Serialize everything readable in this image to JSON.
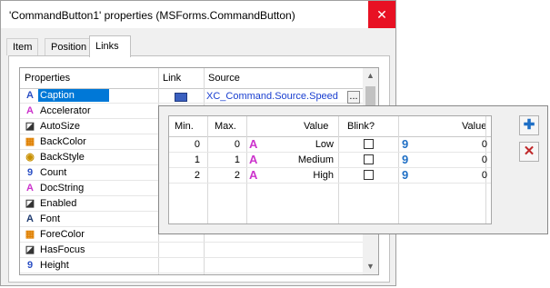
{
  "window": {
    "title": "'CommandButton1' properties (MSForms.CommandButton)",
    "close_glyph": "✕"
  },
  "tabs": [
    {
      "label": "Item"
    },
    {
      "label": "Position"
    },
    {
      "label": "Links",
      "active": true
    }
  ],
  "properties_grid": {
    "columns": [
      "Properties",
      "Link",
      "Source"
    ],
    "rows": [
      {
        "name": "Caption",
        "icon": "text-a-icon",
        "glyph": "A",
        "color": "#2b4fc4",
        "link_icon": "link-grid-icon",
        "source": "XC_Command.Source.Speed",
        "selected": true
      },
      {
        "name": "Accelerator",
        "icon": "text-a-icon",
        "glyph": "A",
        "color": "#cc33cc"
      },
      {
        "name": "AutoSize",
        "icon": "boolean-icon",
        "glyph": "◪",
        "color": "#333333"
      },
      {
        "name": "BackColor",
        "icon": "color-palette-icon",
        "glyph": "▦",
        "color": "#e08000"
      },
      {
        "name": "BackStyle",
        "icon": "style-icon",
        "glyph": "◉",
        "color": "#c89000"
      },
      {
        "name": "Count",
        "icon": "number-icon",
        "glyph": "9",
        "color": "#2b4fc4"
      },
      {
        "name": "DocString",
        "icon": "text-a-icon",
        "glyph": "A",
        "color": "#cc33cc"
      },
      {
        "name": "Enabled",
        "icon": "boolean-icon",
        "glyph": "◪",
        "color": "#333333"
      },
      {
        "name": "Font",
        "icon": "font-icon",
        "glyph": "A",
        "color": "#1f3b70"
      },
      {
        "name": "ForeColor",
        "icon": "color-palette-icon",
        "glyph": "▦",
        "color": "#e08000"
      },
      {
        "name": "HasFocus",
        "icon": "boolean-icon",
        "glyph": "◪",
        "color": "#333333"
      },
      {
        "name": "Height",
        "icon": "number-icon",
        "glyph": "9",
        "color": "#2b4fc4"
      }
    ],
    "browse_label": "..."
  },
  "editor": {
    "columns": [
      "Min.",
      "Max.",
      "Value",
      "Blink?",
      "Value"
    ],
    "rows": [
      {
        "min": "0",
        "max": "0",
        "value_text": "Low",
        "blink": false,
        "value_num": "0"
      },
      {
        "min": "1",
        "max": "1",
        "value_text": "Medium",
        "blink": false,
        "value_num": "0"
      },
      {
        "min": "2",
        "max": "2",
        "value_text": "High",
        "blink": false,
        "value_num": "0"
      }
    ],
    "text_glyph": "A",
    "number_glyph": "9",
    "add_glyph": "✚",
    "remove_glyph": "✕",
    "accent_blue": "#1f6fc5",
    "remove_red": "#c0282a"
  }
}
